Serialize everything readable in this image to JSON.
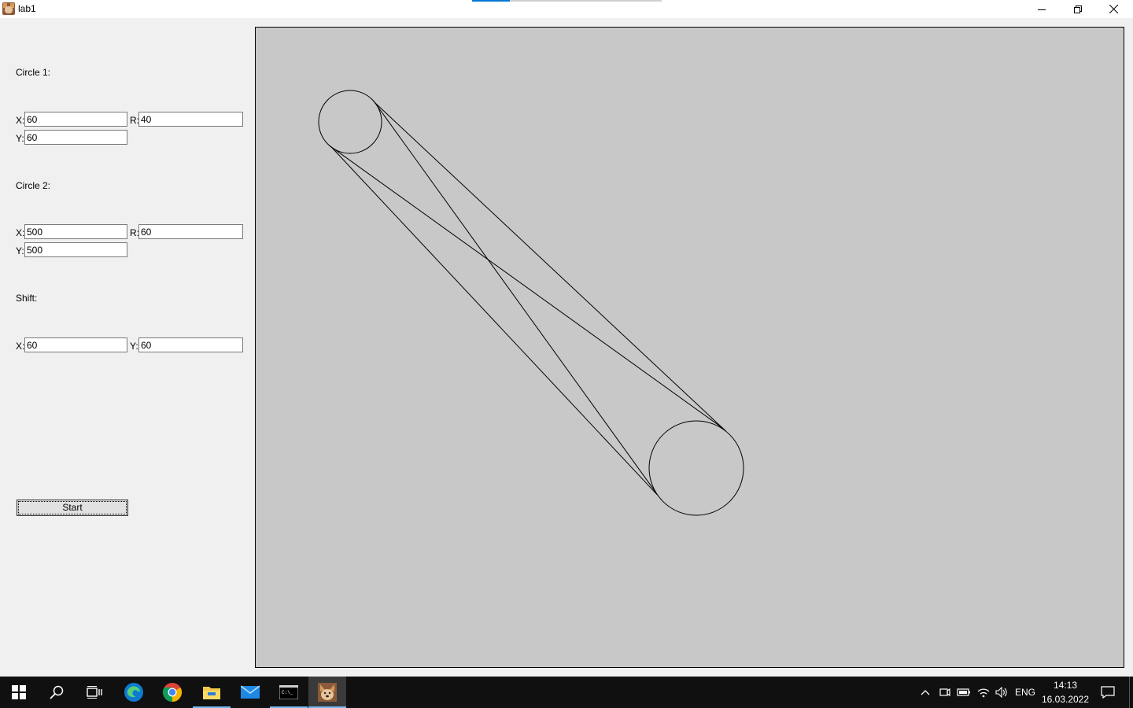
{
  "window": {
    "title": "lab1",
    "progress": 0.2
  },
  "form": {
    "circle1": {
      "heading": "Circle 1:",
      "x_label": "X:",
      "x_value": "60",
      "r_label": "R:",
      "r_value": "40",
      "y_label": "Y:",
      "y_value": "60"
    },
    "circle2": {
      "heading": "Circle 2:",
      "x_label": "X:",
      "x_value": "500",
      "r_label": "R:",
      "r_value": "60",
      "y_label": "Y:",
      "y_value": "500"
    },
    "shift": {
      "heading": "Shift:",
      "x_label": "X:",
      "x_value": "60",
      "y_label": "Y:",
      "y_value": "60"
    },
    "start_label": "Start"
  },
  "taskbar": {
    "icons": [
      "windows-start-icon",
      "search-icon",
      "task-view-icon",
      "edge-icon",
      "chrome-icon",
      "file-explorer-icon",
      "mail-icon",
      "terminal-icon",
      "lab1-app-icon"
    ],
    "language": "ENG",
    "time": "14:13",
    "date": "16.03.2022"
  },
  "colors": {
    "canvas_bg": "#c8c8c8",
    "form_bg": "#f0f0f0",
    "taskbar_bg": "#101010",
    "accent": "#0078d7"
  }
}
